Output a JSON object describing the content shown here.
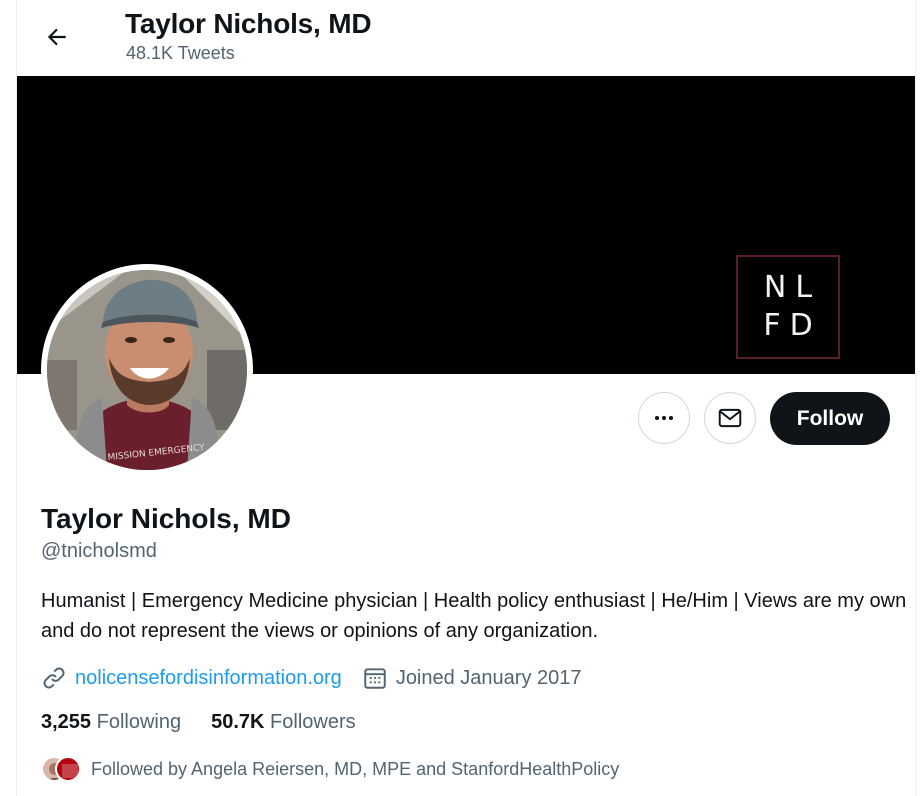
{
  "header": {
    "title": "Taylor Nichols, MD",
    "tweet_count": "48.1K Tweets"
  },
  "banner": {
    "logo_line1": "NL",
    "logo_line2": "FD"
  },
  "avatar": {
    "shirt_text": "MISSION EMERGENCY"
  },
  "actions": {
    "follow_label": "Follow"
  },
  "profile": {
    "name": "Taylor Nichols, MD",
    "handle": "@tnicholsmd",
    "bio": "Humanist | Emergency Medicine physician | Health policy enthusiast | He/Him | Views are my own and do not represent the views or opinions of any organization.",
    "website": "nolicensefordisinformation.org",
    "joined": "Joined January 2017"
  },
  "stats": {
    "following_count": "3,255",
    "following_label": "Following",
    "followers_count": "50.7K",
    "followers_label": "Followers"
  },
  "followed_by": {
    "text": "Followed by Angela Reiersen, MD, MPE and StanfordHealthPolicy"
  },
  "colors": {
    "link": "#1d9bf0",
    "secondary_text": "#536471",
    "primary_text": "#0f1419",
    "banner": "#000000",
    "follow_button": "#0f1419"
  }
}
